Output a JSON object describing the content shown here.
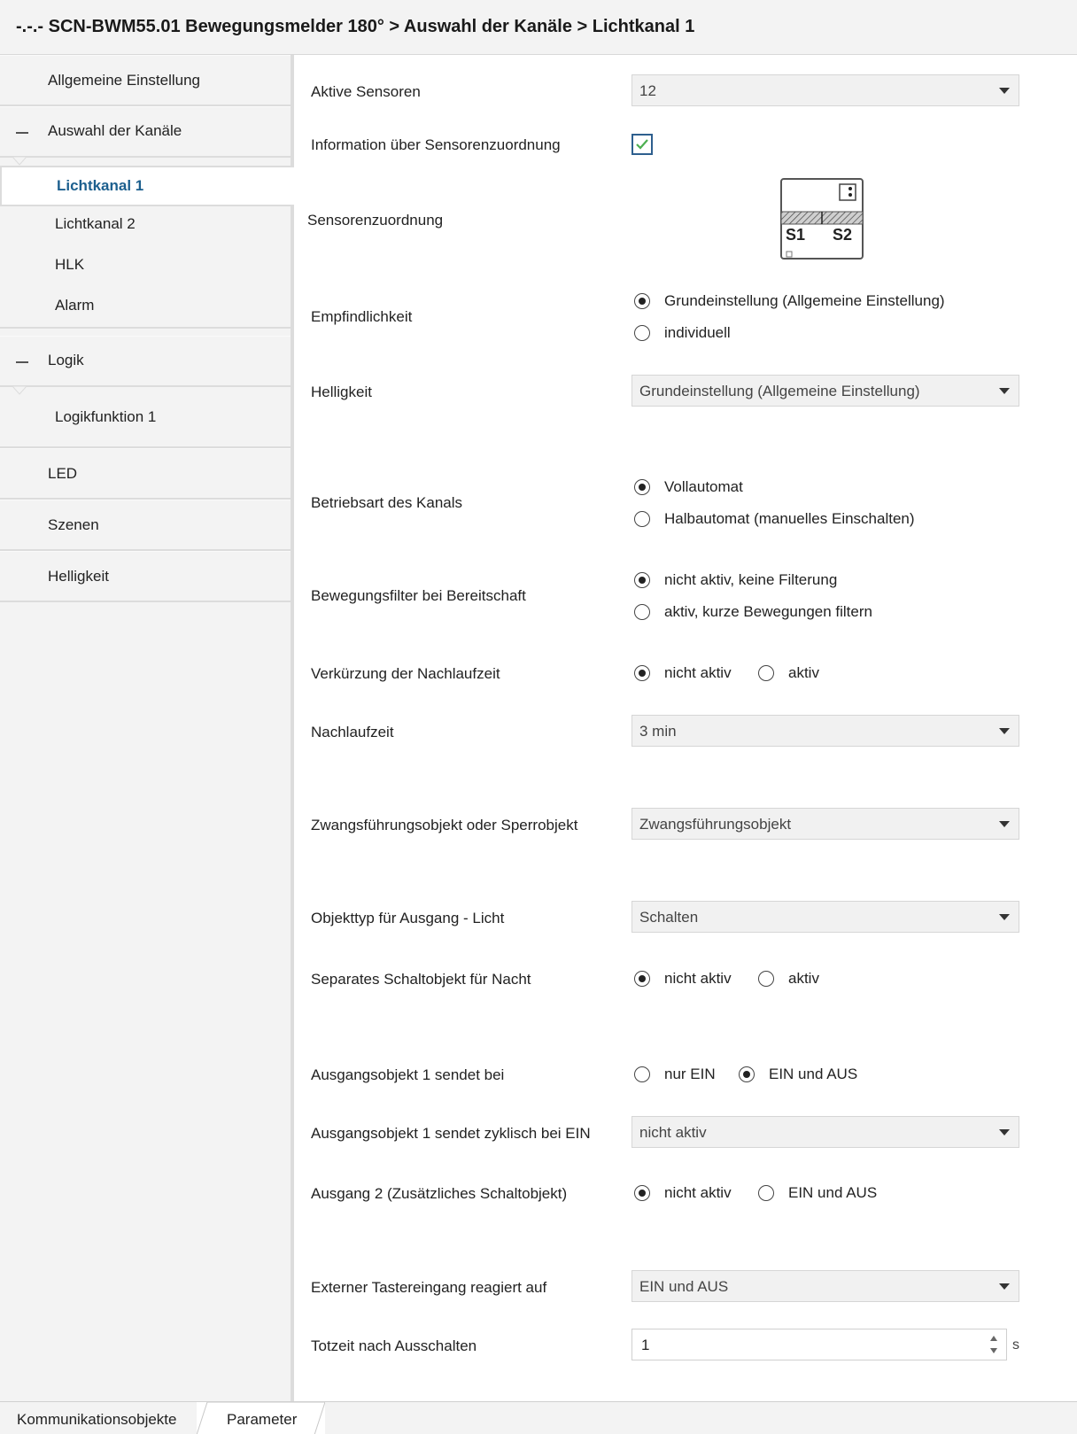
{
  "window": {
    "title": "-.-.- SCN-BWM55.01 Bewegungsmelder 180° > Auswahl der Kanäle > Lichtkanal 1"
  },
  "sidebar": {
    "allgemeine": "Allgemeine Einstellung",
    "auswahl": "Auswahl der Kanäle",
    "lichtkanal1": "Lichtkanal 1",
    "lichtkanal2": "Lichtkanal 2",
    "hlk": "HLK",
    "alarm": "Alarm",
    "logik": "Logik",
    "logikfunktion1": "Logikfunktion 1",
    "led": "LED",
    "szenen": "Szenen",
    "helligkeit": "Helligkeit"
  },
  "params": {
    "aktive_sensoren": {
      "label": "Aktive Sensoren",
      "value": "12"
    },
    "info_sensor": {
      "label": "Information über Sensorenzuordnung",
      "checked": true
    },
    "sensorzuordnung": {
      "label": "Sensorenzuordnung",
      "s1": "S1",
      "s2": "S2"
    },
    "empfindlichkeit": {
      "label": "Empfindlichkeit",
      "opt1": "Grundeinstellung (Allgemeine Einstellung)",
      "opt2": "individuell",
      "selected": "opt1"
    },
    "helligkeit": {
      "label": "Helligkeit",
      "value": "Grundeinstellung (Allgemeine Einstellung)"
    },
    "betriebsart": {
      "label": "Betriebsart des Kanals",
      "opt1": "Vollautomat",
      "opt2": "Halbautomat (manuelles Einschalten)",
      "selected": "opt1"
    },
    "bewegungsfilter": {
      "label": "Bewegungsfilter bei Bereitschaft",
      "opt1": "nicht aktiv, keine Filterung",
      "opt2": "aktiv, kurze Bewegungen filtern",
      "selected": "opt1"
    },
    "verkuerzung": {
      "label": "Verkürzung der Nachlaufzeit",
      "opt1": "nicht aktiv",
      "opt2": "aktiv",
      "selected": "opt1"
    },
    "nachlaufzeit": {
      "label": "Nachlaufzeit",
      "value": "3 min"
    },
    "zwang": {
      "label": "Zwangsführungsobjekt oder Sperrobjekt",
      "value": "Zwangsführungsobjekt"
    },
    "objekttyp": {
      "label": "Objekttyp für Ausgang - Licht",
      "value": "Schalten"
    },
    "separates": {
      "label": "Separates Schaltobjekt für Nacht",
      "opt1": "nicht aktiv",
      "opt2": "aktiv",
      "selected": "opt1"
    },
    "ausgang1": {
      "label": "Ausgangsobjekt 1 sendet bei",
      "opt1": "nur EIN",
      "opt2": "EIN und AUS",
      "selected": "opt2"
    },
    "zyklisch": {
      "label": "Ausgangsobjekt 1 sendet zyklisch bei EIN",
      "value": "nicht aktiv"
    },
    "ausgang2": {
      "label": "Ausgang 2 (Zusätzliches Schaltobjekt)",
      "opt1": "nicht aktiv",
      "opt2": "EIN und AUS",
      "selected": "opt1"
    },
    "extern": {
      "label": "Externer Tastereingang reagiert auf",
      "value": "EIN und AUS"
    },
    "totzeit": {
      "label": "Totzeit nach Ausschalten",
      "value": "1",
      "unit": "s"
    }
  },
  "tabs": {
    "kommunikation": "Kommunikationsobjekte",
    "parameter": "Parameter"
  },
  "colors": {
    "active_nav": "#1c5f8e",
    "checkbox_border": "#2e5f8e",
    "checkmark": "#4caf50"
  }
}
